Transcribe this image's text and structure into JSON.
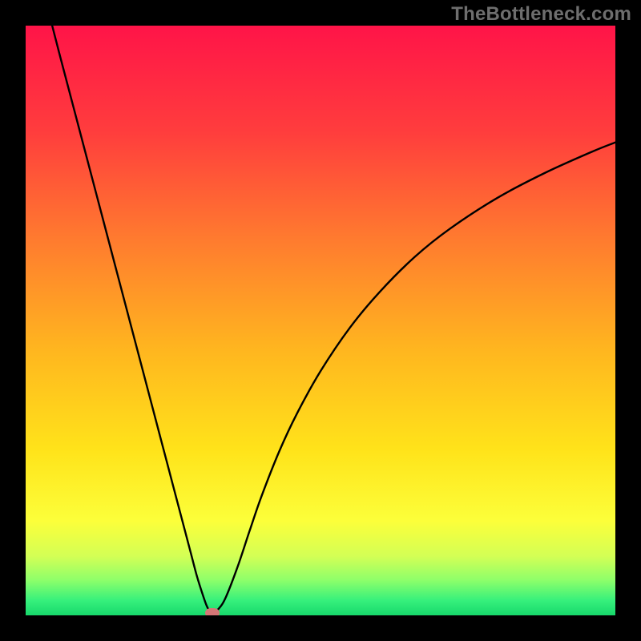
{
  "watermark": "TheBottleneck.com",
  "chart_data": {
    "type": "line",
    "title": "",
    "xlabel": "",
    "ylabel": "",
    "xlim": [
      0,
      100
    ],
    "ylim": [
      0,
      100
    ],
    "grid": false,
    "legend": false,
    "background_gradient_stops": [
      {
        "offset": 0.0,
        "color": "#ff1448"
      },
      {
        "offset": 0.18,
        "color": "#ff3d3d"
      },
      {
        "offset": 0.36,
        "color": "#ff7a2f"
      },
      {
        "offset": 0.55,
        "color": "#ffb61f"
      },
      {
        "offset": 0.72,
        "color": "#ffe31a"
      },
      {
        "offset": 0.84,
        "color": "#fcff3a"
      },
      {
        "offset": 0.9,
        "color": "#d3ff55"
      },
      {
        "offset": 0.94,
        "color": "#8eff6a"
      },
      {
        "offset": 0.975,
        "color": "#36f07c"
      },
      {
        "offset": 1.0,
        "color": "#17d86b"
      }
    ],
    "series": [
      {
        "name": "bottleneck-curve",
        "color": "#000000",
        "x": [
          4.5,
          6,
          8,
          10,
          12,
          14,
          16,
          18,
          20,
          22,
          24,
          26,
          28,
          29,
          30,
          30.8,
          31.6,
          32.8,
          34,
          36,
          38,
          40,
          43,
          46,
          50,
          55,
          60,
          66,
          72,
          80,
          88,
          96,
          100
        ],
        "y": [
          100,
          94.2,
          86.6,
          79,
          71.4,
          63.8,
          56.2,
          48.6,
          41,
          33.4,
          25.8,
          18.2,
          10.6,
          6.8,
          3.6,
          1.4,
          0.4,
          1.2,
          3.2,
          8.4,
          14.4,
          20.2,
          27.8,
          34.2,
          41.4,
          48.8,
          54.8,
          60.8,
          65.6,
          70.8,
          75,
          78.6,
          80.2
        ]
      }
    ],
    "marker": {
      "x": 31.6,
      "y": 0.4,
      "color": "#d47676"
    }
  }
}
